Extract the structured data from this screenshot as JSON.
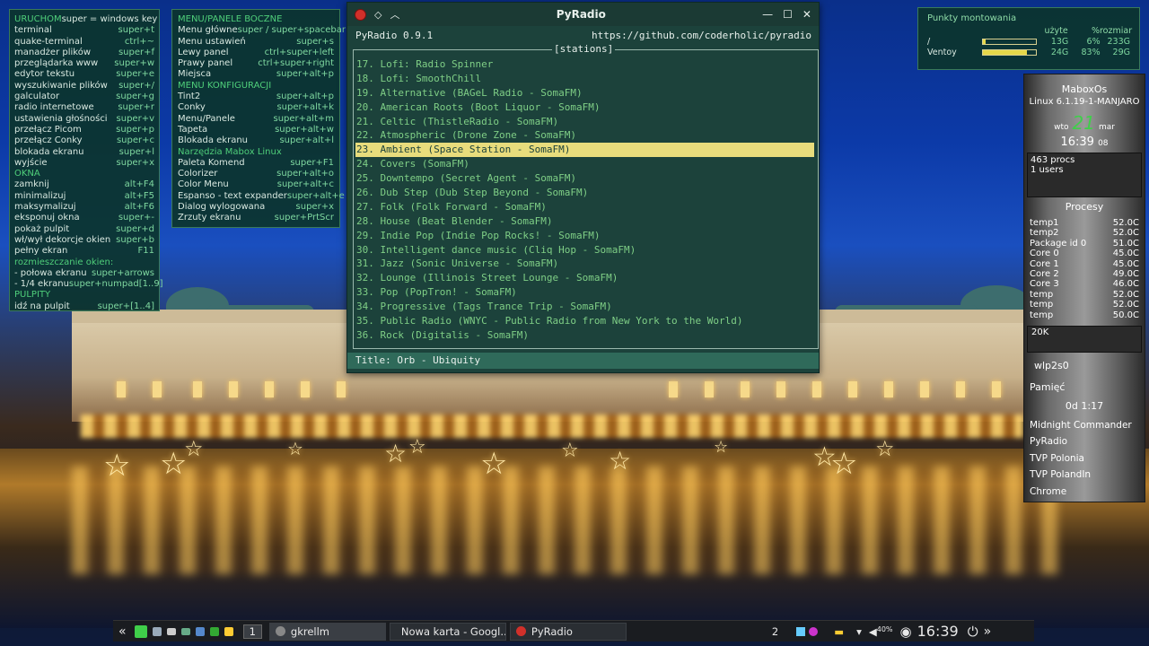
{
  "conky_left": {
    "rows": [
      {
        "label": "URUCHOM",
        "key": "super = windows key",
        "section": true
      },
      {
        "label": "terminal",
        "key": "super+t"
      },
      {
        "label": "quake-terminal",
        "key": "ctrl+~"
      },
      {
        "label": "manadżer plików",
        "key": "super+f"
      },
      {
        "label": "przeglądarka www",
        "key": "super+w"
      },
      {
        "label": "edytor tekstu",
        "key": "super+e"
      },
      {
        "label": "wyszukiwanie plików",
        "key": "super+/"
      },
      {
        "label": "galculator",
        "key": "super+g"
      },
      {
        "label": "radio internetowe",
        "key": "super+r"
      },
      {
        "label": "ustawienia głośności",
        "key": "super+v"
      },
      {
        "label": "przełącz Picom",
        "key": "super+p"
      },
      {
        "label": "przełącz Conky",
        "key": "super+c"
      },
      {
        "label": "blokada ekranu",
        "key": "super+l"
      },
      {
        "label": "wyjście",
        "key": "super+x"
      },
      {
        "label": "OKNA",
        "key": "",
        "section": true
      },
      {
        "label": "zamknij",
        "key": "alt+F4"
      },
      {
        "label": "minimalizuj",
        "key": "alt+F5"
      },
      {
        "label": "maksymalizuj",
        "key": "alt+F6"
      },
      {
        "label": "eksponuj okna",
        "key": "super+-"
      },
      {
        "label": "pokaż pulpit",
        "key": "super+d"
      },
      {
        "label": "wł/wył dekorcje okien",
        "key": "super+b"
      },
      {
        "label": "pełny ekran",
        "key": "F11"
      },
      {
        "label": "rozmieszczanie okien:",
        "key": "",
        "section": true
      },
      {
        "label": " - połowa ekranu",
        "key": "super+arrows"
      },
      {
        "label": " - 1/4 ekranu",
        "key": "super+numpad[1..9]"
      },
      {
        "label": "PULPITY",
        "key": "",
        "section": true
      },
      {
        "label": "idź na pulpit",
        "key": "super+[1..4]"
      }
    ]
  },
  "conky_mid": {
    "rows": [
      {
        "label": "MENU/PANELE BOCZNE",
        "key": "",
        "section": true
      },
      {
        "label": "Menu główne",
        "key": "super / super+spacebar"
      },
      {
        "label": "Menu ustawień",
        "key": "super+s"
      },
      {
        "label": "Lewy panel",
        "key": "ctrl+super+left"
      },
      {
        "label": "Prawy panel",
        "key": "ctrl+super+right"
      },
      {
        "label": "Miejsca",
        "key": "super+alt+p"
      },
      {
        "label": "MENU KONFIGURACJI",
        "key": "",
        "section": true
      },
      {
        "label": "Tint2",
        "key": "super+alt+p"
      },
      {
        "label": "Conky",
        "key": "super+alt+k"
      },
      {
        "label": "Menu/Panele",
        "key": "super+alt+m"
      },
      {
        "label": "Tapeta",
        "key": "super+alt+w"
      },
      {
        "label": "Blokada ekranu",
        "key": "super+alt+l"
      },
      {
        "label": "Narzędzia Mabox Linux",
        "key": "",
        "section": true
      },
      {
        "label": "Paleta Komend",
        "key": "super+F1"
      },
      {
        "label": "Colorizer",
        "key": "super+alt+o"
      },
      {
        "label": "Color Menu",
        "key": "super+alt+c"
      },
      {
        "label": "Espanso - text expander",
        "key": "super+alt+e"
      },
      {
        "label": "Dialog wylogowana",
        "key": "super+x"
      },
      {
        "label": "Zrzuty ekranu",
        "key": "super+PrtScr"
      }
    ]
  },
  "mounts": {
    "title": "Punkty montowania",
    "headers": {
      "used": "użyte",
      "pct": "%",
      "size": "rozmiar"
    },
    "rows": [
      {
        "name": "/",
        "fill": 0.06,
        "used": "13G",
        "pct": "6%",
        "size": "233G"
      },
      {
        "name": "Ventoy",
        "fill": 0.83,
        "used": "24G",
        "pct": "83%",
        "size": "29G"
      }
    ]
  },
  "gkrellm": {
    "host": "MaboxOs",
    "kernel": "Linux 6.1.19-1-MANJARO",
    "weekday": "wto",
    "day": "21",
    "month": "mar",
    "time": "16:39",
    "seconds": "08",
    "procs": "463 procs",
    "users": "1 users",
    "proc_label": "Procesy",
    "temps": [
      {
        "name": "temp1",
        "val": "52.0C"
      },
      {
        "name": "temp2",
        "val": "52.0C"
      },
      {
        "name": "Package id 0",
        "val": "51.0C"
      },
      {
        "name": "Core 0",
        "val": "45.0C"
      },
      {
        "name": "Core 1",
        "val": "45.0C"
      },
      {
        "name": "Core 2",
        "val": "49.0C"
      },
      {
        "name": "Core 3",
        "val": "46.0C"
      },
      {
        "name": "temp",
        "val": "52.0C"
      },
      {
        "name": "temp",
        "val": "52.0C"
      },
      {
        "name": "temp",
        "val": "50.0C"
      }
    ],
    "disk": "20K",
    "net": "wlp2s0",
    "mem": "Pamięć",
    "uptime": "0d  1:17",
    "apps": [
      "Midnight Commander",
      "PyRadio",
      "TVP Polonia",
      "TVP PolandIn",
      "Chrome"
    ]
  },
  "pyradio": {
    "window_title": "PyRadio",
    "header_left": "PyRadio 0.9.1",
    "header_right": "https://github.com/coderholic/pyradio",
    "box_title": "[stations]",
    "selected_index": 6,
    "stations": [
      "17. Lofi: Radio Spinner",
      "18. Lofi: SmoothChill",
      "19. Alternative (BAGeL Radio - SomaFM)",
      "20. American Roots (Boot Liquor - SomaFM)",
      "21. Celtic (ThistleRadio - SomaFM)",
      "22. Atmospheric (Drone Zone - SomaFM)",
      "23. Ambient (Space Station  - SomaFM)",
      "24. Covers (SomaFM)",
      "25. Downtempo (Secret Agent - SomaFM)",
      "26. Dub Step (Dub Step Beyond - SomaFM)",
      "27. Folk (Folk Forward - SomaFM)",
      "28. House (Beat Blender - SomaFM)",
      "29. Indie Pop (Indie Pop Rocks! - SomaFM)",
      "30. Intelligent dance music (Cliq Hop - SomaFM)",
      "31. Jazz (Sonic Universe - SomaFM)",
      "32. Lounge (Illinois Street Lounge - SomaFM)",
      "33. Pop (PopTron! - SomaFM)",
      "34. Progressive (Tags Trance Trip - SomaFM)",
      "35. Public Radio (WNYC - Public Radio from New York to the World)",
      "36. Rock (Digitalis - SomaFM)"
    ],
    "status": "Title: Orb - Ubiquity"
  },
  "taskbar": {
    "desktop_num": "1",
    "tasks": [
      {
        "label": "gkrellm",
        "icon": "gkrellm-icon"
      },
      {
        "label": "Nowa karta - Googl...",
        "icon": "chrome-icon"
      },
      {
        "label": "PyRadio",
        "icon": "pyradio-icon"
      }
    ],
    "tray_count": "2",
    "volume": "40%",
    "clock": "16:39"
  }
}
